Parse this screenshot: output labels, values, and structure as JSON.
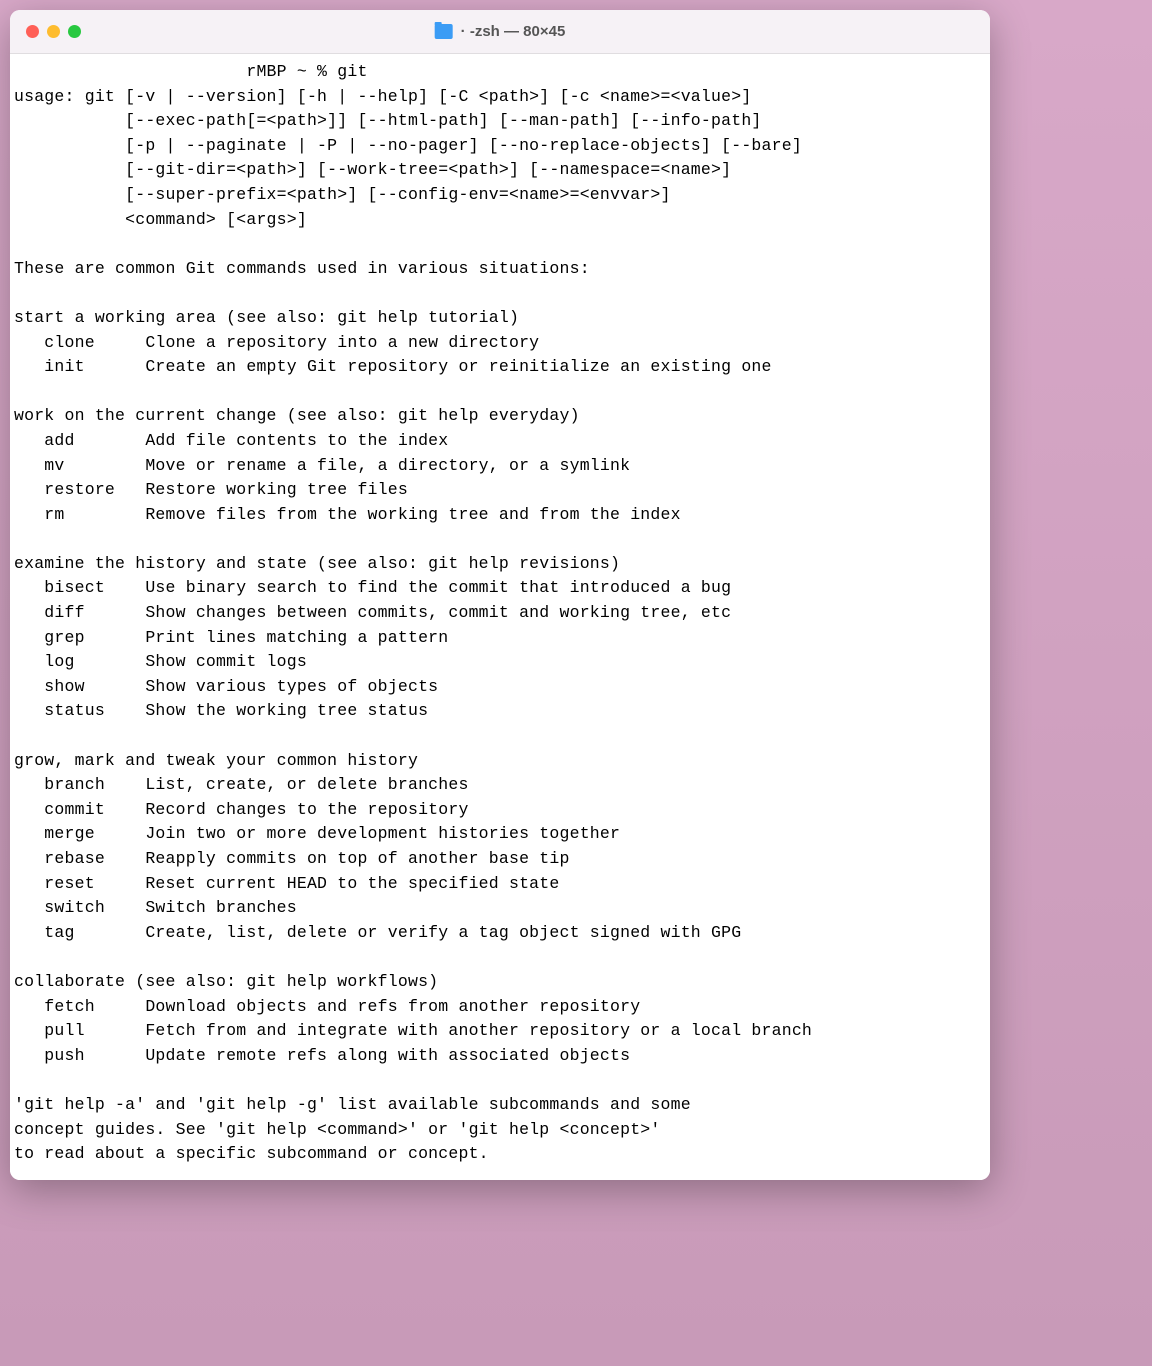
{
  "window": {
    "title": "· -zsh — 80×45"
  },
  "terminal": {
    "prompt_host": "rMBP",
    "prompt_path": "~",
    "prompt_symbol": "%",
    "command": "git",
    "usage_lines": [
      "usage: git [-v | --version] [-h | --help] [-C <path>] [-c <name>=<value>]",
      "           [--exec-path[=<path>]] [--html-path] [--man-path] [--info-path]",
      "           [-p | --paginate | -P | --no-pager] [--no-replace-objects] [--bare]",
      "           [--git-dir=<path>] [--work-tree=<path>] [--namespace=<name>]",
      "           [--super-prefix=<path>] [--config-env=<name>=<envvar>]",
      "           <command> [<args>]"
    ],
    "intro": "These are common Git commands used in various situations:",
    "sections": [
      {
        "heading": "start a working area (see also: git help tutorial)",
        "commands": [
          {
            "name": "clone",
            "desc": "Clone a repository into a new directory"
          },
          {
            "name": "init",
            "desc": "Create an empty Git repository or reinitialize an existing one"
          }
        ]
      },
      {
        "heading": "work on the current change (see also: git help everyday)",
        "commands": [
          {
            "name": "add",
            "desc": "Add file contents to the index"
          },
          {
            "name": "mv",
            "desc": "Move or rename a file, a directory, or a symlink"
          },
          {
            "name": "restore",
            "desc": "Restore working tree files"
          },
          {
            "name": "rm",
            "desc": "Remove files from the working tree and from the index"
          }
        ]
      },
      {
        "heading": "examine the history and state (see also: git help revisions)",
        "commands": [
          {
            "name": "bisect",
            "desc": "Use binary search to find the commit that introduced a bug"
          },
          {
            "name": "diff",
            "desc": "Show changes between commits, commit and working tree, etc"
          },
          {
            "name": "grep",
            "desc": "Print lines matching a pattern"
          },
          {
            "name": "log",
            "desc": "Show commit logs"
          },
          {
            "name": "show",
            "desc": "Show various types of objects"
          },
          {
            "name": "status",
            "desc": "Show the working tree status"
          }
        ]
      },
      {
        "heading": "grow, mark and tweak your common history",
        "commands": [
          {
            "name": "branch",
            "desc": "List, create, or delete branches"
          },
          {
            "name": "commit",
            "desc": "Record changes to the repository"
          },
          {
            "name": "merge",
            "desc": "Join two or more development histories together"
          },
          {
            "name": "rebase",
            "desc": "Reapply commits on top of another base tip"
          },
          {
            "name": "reset",
            "desc": "Reset current HEAD to the specified state"
          },
          {
            "name": "switch",
            "desc": "Switch branches"
          },
          {
            "name": "tag",
            "desc": "Create, list, delete or verify a tag object signed with GPG"
          }
        ]
      },
      {
        "heading": "collaborate (see also: git help workflows)",
        "commands": [
          {
            "name": "fetch",
            "desc": "Download objects and refs from another repository"
          },
          {
            "name": "pull",
            "desc": "Fetch from and integrate with another repository or a local branch"
          },
          {
            "name": "push",
            "desc": "Update remote refs along with associated objects"
          }
        ]
      }
    ],
    "footer_lines": [
      "'git help -a' and 'git help -g' list available subcommands and some",
      "concept guides. See 'git help <command>' or 'git help <concept>'",
      "to read about a specific subcommand or concept."
    ]
  }
}
